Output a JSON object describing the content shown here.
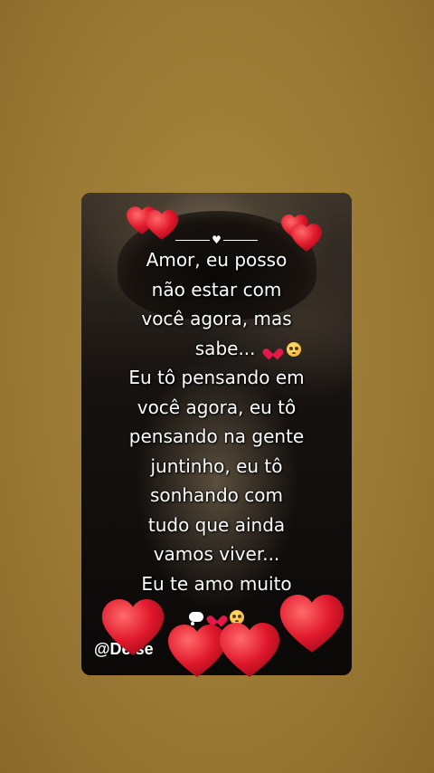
{
  "message": {
    "lines": [
      "Amor,  eu posso",
      "não  estar com",
      "você agora,  mas",
      "sabe...",
      "Eu tô pensando  em",
      "você agora, eu tô",
      "pensando na gente",
      "juntinho, eu tô",
      "sonhando com",
      "tudo que ainda",
      "vamos viver...",
      "Eu te amo muito"
    ]
  },
  "watermark": "@Deise",
  "icons": {
    "heart": "red-heart-icon",
    "face": "pleading-face-icon",
    "thought": "thought-bubble-icon"
  },
  "colors": {
    "heart": "#e0182c",
    "background": "#9a7a34",
    "card": "#0b0908",
    "text": "#ffffff"
  }
}
